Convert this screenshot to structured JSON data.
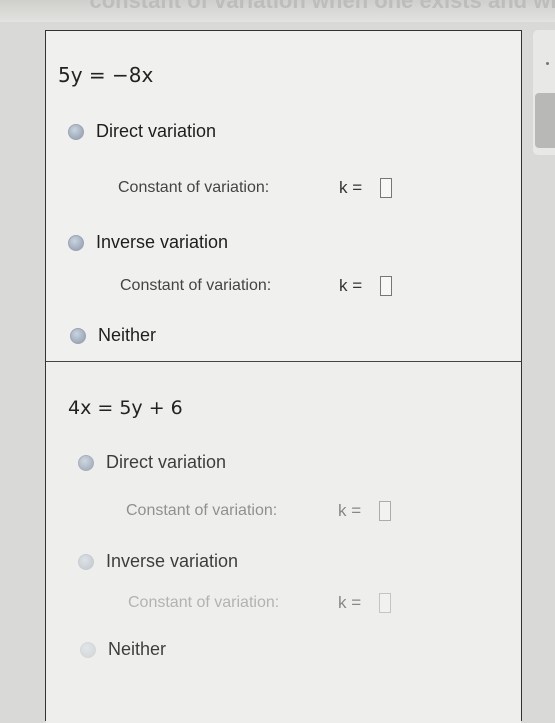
{
  "header_partial": "constant of variation when one exists and wri",
  "problems": [
    {
      "equation": "5y = −8x",
      "options": [
        {
          "label": "Direct variation"
        },
        {
          "label": "Inverse variation"
        },
        {
          "label": "Neither"
        }
      ],
      "constant_label": "Constant of variation:",
      "k_label": "k ="
    },
    {
      "equation": "4x = 5y + 6",
      "options": [
        {
          "label": "Direct variation"
        },
        {
          "label": "Inverse variation"
        },
        {
          "label": "Neither"
        }
      ],
      "constant_label": "Constant of variation:",
      "k_label": "k ="
    }
  ]
}
